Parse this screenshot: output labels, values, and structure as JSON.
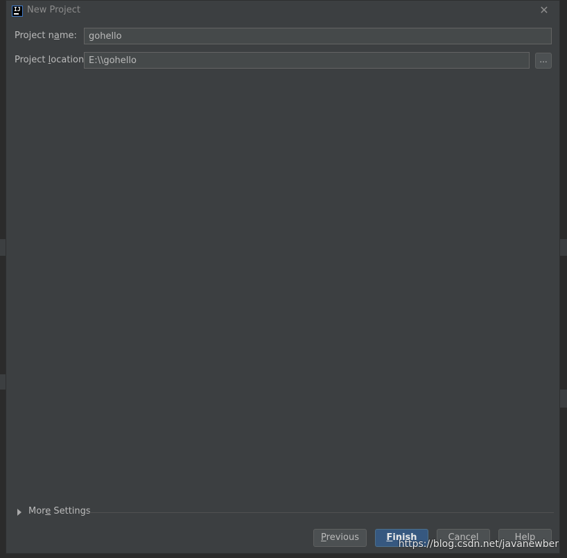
{
  "window": {
    "title": "New Project"
  },
  "form": {
    "project_name": {
      "label_pre": "Project n",
      "label_mnemonic": "a",
      "label_post": "me:",
      "value": "gohello"
    },
    "project_location": {
      "label_pre": "Project ",
      "label_mnemonic": "l",
      "label_post": "ocation:",
      "value": "E:\\\\gohello"
    },
    "browse_label": "..."
  },
  "more_settings": {
    "pre": "Mor",
    "mnemonic": "e",
    "post": " Settings"
  },
  "buttons": {
    "previous": {
      "mnemonic": "P",
      "rest": "revious"
    },
    "finish": {
      "mnemonic": "F",
      "rest": "inish"
    },
    "cancel": "Cancel",
    "help": "Help"
  },
  "watermark": "https://blog.csdn.net/javanewber",
  "icons": {
    "app": "intellij-app-icon",
    "close": "close-icon",
    "expand": "triangle-right-icon"
  },
  "colors": {
    "dialog_bg": "#3c3f41",
    "primary_button": "#365880",
    "input_bg": "#45494a",
    "text": "#bbbbbb"
  }
}
